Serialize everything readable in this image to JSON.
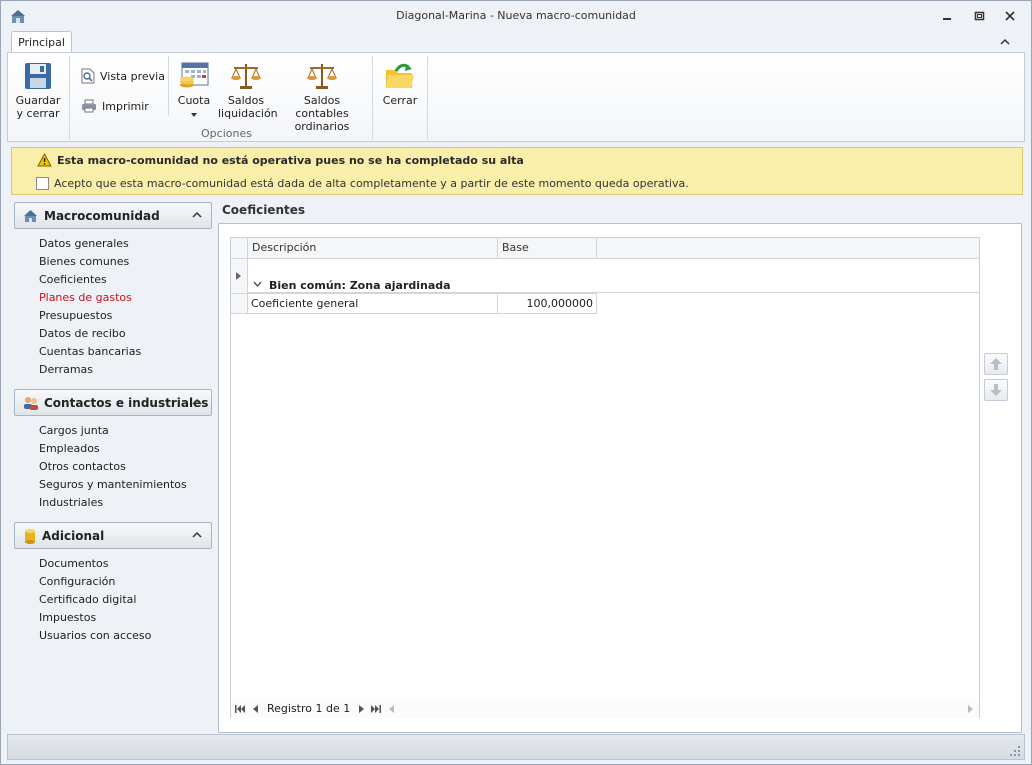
{
  "window": {
    "title": "Diagonal-Marina - Nueva macro-comunidad"
  },
  "ribbon": {
    "tab": "Principal",
    "save_line1": "Guardar",
    "save_line2": "y cerrar",
    "preview": "Vista previa",
    "print": "Imprimir",
    "quota": "Cuota",
    "balances_line1": "Saldos",
    "balances_line2": "liquidación",
    "accounting_line1": "Saldos contables",
    "accounting_line2": "ordinarios",
    "options_group": "Opciones",
    "close": "Cerrar"
  },
  "warning": {
    "title": "Esta macro-comunidad no está operativa pues no se ha completado su alta",
    "checkbox_label": "Acepto que esta macro-comunidad está dada de alta completamente y a partir de este momento queda operativa."
  },
  "nav": {
    "groups": [
      {
        "title": "Macrocomunidad",
        "items": [
          "Datos generales",
          "Bienes comunes",
          "Coeficientes",
          "Planes de gastos",
          "Presupuestos",
          "Datos de recibo",
          "Cuentas bancarias",
          "Derramas"
        ]
      },
      {
        "title": "Contactos e industriales",
        "items": [
          "Cargos junta",
          "Empleados",
          "Otros contactos",
          "Seguros y mantenimientos",
          "Industriales"
        ]
      },
      {
        "title": "Adicional",
        "items": [
          "Documentos",
          "Configuración",
          "Certificado digital",
          "Impuestos",
          "Usuarios con acceso"
        ]
      }
    ]
  },
  "content": {
    "section_title": "Coeficientes",
    "grid": {
      "columns": [
        "Descripción",
        "Base"
      ],
      "group_row": "Bien común: Zona ajardinada",
      "rows": [
        {
          "description": "Coeficiente general",
          "base": "100,000000"
        }
      ],
      "record_label": "Registro 1 de 1"
    }
  }
}
